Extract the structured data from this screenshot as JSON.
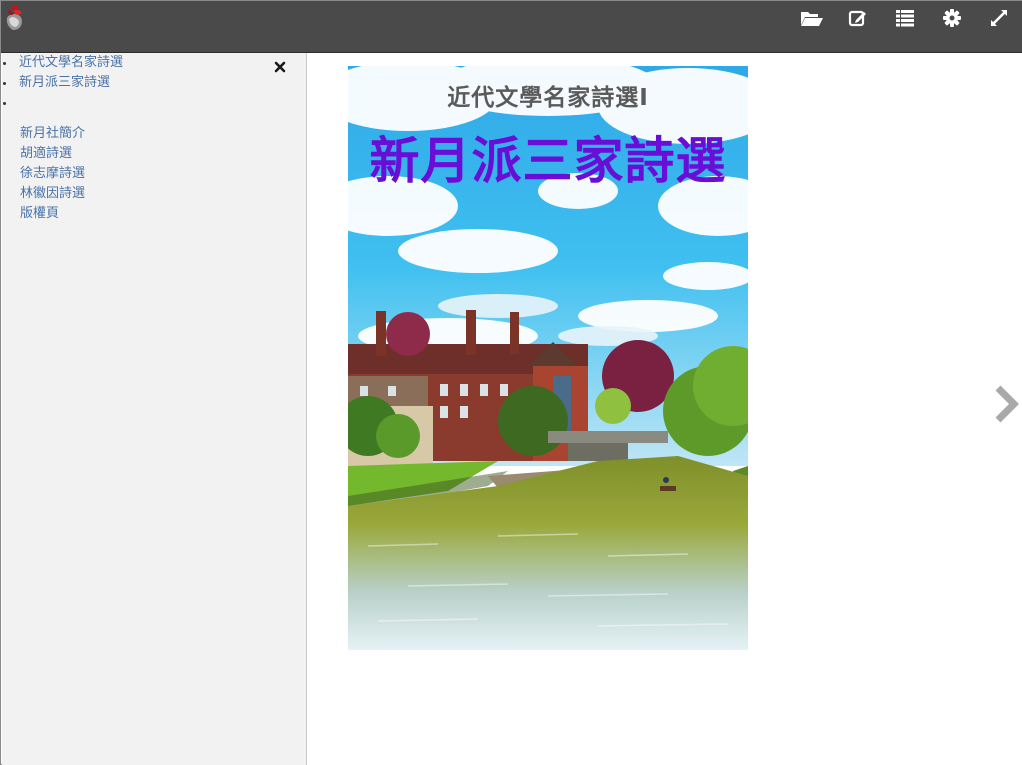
{
  "toolbar": {
    "icons": [
      "app-logo-icon",
      "folder-open-icon",
      "edit-icon",
      "list-icon",
      "gear-icon",
      "fullscreen-icon"
    ]
  },
  "sidebar": {
    "top_items": [
      {
        "label": "近代文學名家詩選"
      },
      {
        "label": "新月派三家詩選"
      },
      {
        "label": ""
      }
    ],
    "sub_items": [
      {
        "label": "新月社簡介"
      },
      {
        "label": "胡適詩選"
      },
      {
        "label": "徐志摩詩選"
      },
      {
        "label": "林徽因詩選"
      },
      {
        "label": "版權頁"
      }
    ],
    "close_icon": "close-icon"
  },
  "book": {
    "series": "近代文學名家詩選I",
    "title": "新月派三家詩選"
  },
  "navigation": {
    "next_icon": "chevron-right-icon"
  },
  "colors": {
    "toolbar_bg": "#4a4a4a",
    "sidebar_bg": "#f2f2f2",
    "link": "#4a72a6",
    "cover_title": "#6a0dd6",
    "cover_series": "#5a5a5a"
  }
}
